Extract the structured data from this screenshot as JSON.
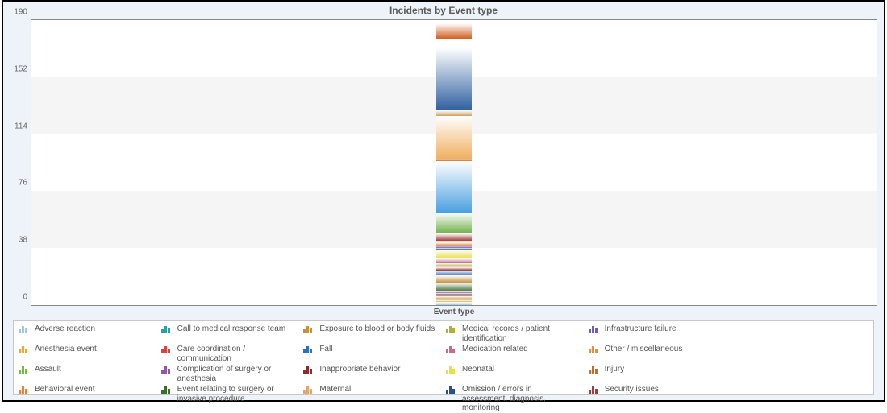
{
  "title": "Incidents by Event type",
  "xlabel": "Event type",
  "chart_data": {
    "type": "bar",
    "stacked": true,
    "categories": [
      "Event type"
    ],
    "ylim": [
      0,
      190
    ],
    "yticks": [
      0,
      38,
      76,
      114,
      152,
      190
    ],
    "xlabel": "Event type",
    "title": "Incidents by Event type",
    "series": [
      {
        "name": "Adverse reaction",
        "color": "#9ec9e2",
        "values": [
          2
        ]
      },
      {
        "name": "Anesthesia event",
        "color": "#f0a930",
        "values": [
          1
        ]
      },
      {
        "name": "Assault",
        "color": "#7db642",
        "values": [
          1
        ]
      },
      {
        "name": "Behavioral event",
        "color": "#f08030",
        "values": [
          2
        ]
      },
      {
        "name": "Call to medical response team",
        "color": "#2f9e9e",
        "values": [
          1
        ]
      },
      {
        "name": "Care coordination / communication",
        "color": "#d94545",
        "values": [
          1
        ]
      },
      {
        "name": "Complication of surgery or anesthesia",
        "color": "#8e5aa8",
        "values": [
          1
        ]
      },
      {
        "name": "Event relating to surgery or invasive procedure",
        "color": "#3d6e2f",
        "values": [
          6
        ]
      },
      {
        "name": "Exposure to blood or body fluids",
        "color": "#c7903d",
        "values": [
          5
        ]
      },
      {
        "name": "Fall",
        "color": "#2f6fbf",
        "values": [
          3
        ]
      },
      {
        "name": "Inappropriate behavior",
        "color": "#8c2d2d",
        "values": [
          2
        ]
      },
      {
        "name": "Maternal",
        "color": "#e0a86a",
        "values": [
          1
        ]
      },
      {
        "name": "Medical records / patient identification",
        "color": "#b0b038",
        "values": [
          2
        ]
      },
      {
        "name": "Medication related",
        "color": "#c76b8a",
        "values": [
          3
        ]
      },
      {
        "name": "Neonatal",
        "color": "#e8e04a",
        "values": [
          6
        ]
      },
      {
        "name": "Omission / errors in assessment, diagnosis, monitoring",
        "color": "#2a508c",
        "values": [
          1
        ]
      },
      {
        "name": "Infrastructure failure",
        "color": "#7a5ab0",
        "values": [
          2
        ]
      },
      {
        "name": "Other / miscellaneous",
        "color": "#e09040",
        "values": [
          2
        ]
      },
      {
        "name": "Injury",
        "color": "#c76a2a",
        "values": [
          1
        ]
      },
      {
        "name": "Security issues",
        "color": "#a33d3d",
        "values": [
          5
        ]
      },
      {
        "name": "_segA",
        "color": "#70b04a",
        "values": [
          14
        ],
        "hidden_in_legend": true
      },
      {
        "name": "_segB",
        "color": "#4aa0e0",
        "values": [
          34
        ],
        "hidden_in_legend": true
      },
      {
        "name": "_segC_thin",
        "color": "#c76a2a",
        "values": [
          2
        ],
        "hidden_in_legend": true
      },
      {
        "name": "_segD",
        "color": "#f0b060",
        "values": [
          28
        ],
        "hidden_in_legend": true
      },
      {
        "name": "_segE_tan",
        "color": "#d0a060",
        "values": [
          4
        ],
        "hidden_in_legend": true
      },
      {
        "name": "_segF_navy",
        "color": "#3060a0",
        "values": [
          42
        ],
        "hidden_in_legend": true
      },
      {
        "name": "_segG_white",
        "color": "#ffffff",
        "values": [
          6
        ],
        "hidden_in_legend": true
      },
      {
        "name": "_segH_orange",
        "color": "#d06020",
        "values": [
          10
        ],
        "hidden_in_legend": true
      }
    ]
  },
  "legend_order": [
    "Adverse reaction",
    "Anesthesia event",
    "Assault",
    "Behavioral event",
    "Call to medical response team",
    "Care coordination / communication",
    "Complication of surgery or anesthesia",
    "Event relating to surgery or invasive procedure",
    "Exposure to blood or body fluids",
    "Fall",
    "Inappropriate behavior",
    "Maternal",
    "Medical records / patient identification",
    "Medication related",
    "Neonatal",
    "Omission / errors in assessment, diagnosis, monitoring",
    "Infrastructure failure",
    "Other / miscellaneous",
    "Injury",
    "Security issues"
  ]
}
